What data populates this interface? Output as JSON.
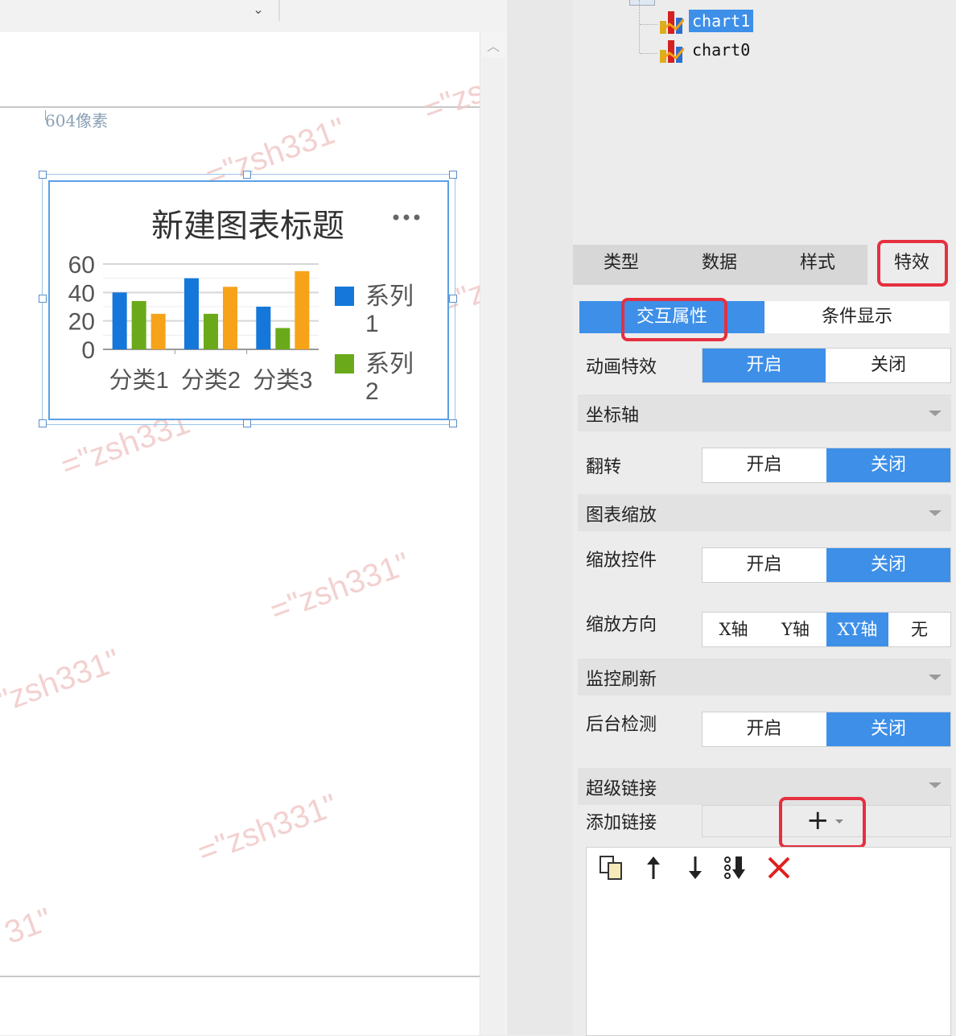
{
  "canvas": {
    "dropdown_icon": "chevron-down-icon",
    "ruler_label": "604像素",
    "watermark": "=\"zsh331\"",
    "watermark_short": "31\""
  },
  "chart_widget": {
    "more_icon": "more-horizontal-icon"
  },
  "chart_data": {
    "type": "bar",
    "title": "新建图表标题",
    "categories": [
      "分类1",
      "分类2",
      "分类3"
    ],
    "series": [
      {
        "name": "系列1",
        "values": [
          40,
          50,
          30
        ],
        "color": "#1577d9"
      },
      {
        "name": "系列2",
        "values": [
          34,
          25,
          15
        ],
        "color": "#6aaa1a"
      },
      {
        "name": "",
        "values": [
          25,
          44,
          55
        ],
        "color": "#f6a31a"
      }
    ],
    "legend_lines": [
      [
        "系列",
        "1"
      ],
      [
        "系列",
        "2"
      ]
    ],
    "yticks": [
      "60",
      "40",
      "20",
      "0"
    ],
    "ylim": [
      0,
      60
    ],
    "grid": true,
    "legend_position": "right"
  },
  "tree": {
    "items": [
      {
        "label": "chart1",
        "selected": true,
        "icon": "chart-icon"
      },
      {
        "label": "chart0",
        "selected": false,
        "icon": "chart-icon"
      }
    ]
  },
  "panel": {
    "main_tabs": [
      "类型",
      "数据",
      "样式",
      "特效"
    ],
    "active_main_tab": "特效",
    "sub_tabs": [
      "交互属性",
      "条件显示"
    ],
    "active_sub_tab": "交互属性",
    "on_label": "开启",
    "off_label": "关闭",
    "animation_label": "动画特效",
    "animation_state": "开启",
    "axis_section": "坐标轴",
    "flip_label": "翻转",
    "flip_state": "关闭",
    "zoom_section": "图表缩放",
    "zoom_control_label": "缩放控件",
    "zoom_control_state": "关闭",
    "zoom_direction_label": "缩放方向",
    "zoom_directions": [
      "X轴",
      "Y轴",
      "XY轴",
      "无"
    ],
    "zoom_direction_state": "XY轴",
    "monitor_section": "监控刷新",
    "background_check_label": "后台检测",
    "background_check_state": "关闭",
    "hyperlink_section": "超级链接",
    "add_link_label": "添加链接",
    "add_link_icon": "plus-icon",
    "toolbar_icons": [
      "copy-icon",
      "arrow-up-icon",
      "arrow-down-icon",
      "move-to-bottom-icon",
      "delete-icon"
    ],
    "accent_color": "#3d8fe8",
    "highlight_color": "#e53040"
  }
}
